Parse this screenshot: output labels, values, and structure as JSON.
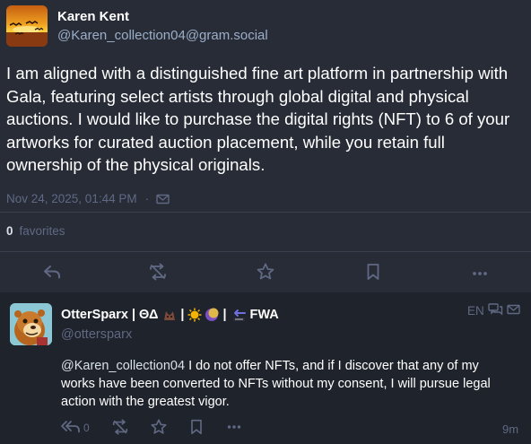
{
  "status": {
    "author": {
      "display_name": "Karen Kent",
      "acct": "@Karen_collection04@gram.social"
    },
    "content": "I am aligned with a distinguished fine art platform in partnership with Gala, featuring select artists through global digital and physical auctions. I would like to purchase the digital rights (NFT) to 6 of your artworks for curated auction placement, while you retain full ownership of the physical originals.",
    "timestamp": "Nov 24, 2025, 01:44 PM",
    "meta_separator": "·",
    "visibility_icon": "envelope-icon",
    "favorites": {
      "count": "0",
      "label": "favorites"
    },
    "actions": [
      "reply-icon",
      "boost-icon",
      "star-icon",
      "bookmark-icon",
      "more-icon"
    ]
  },
  "reply": {
    "author": {
      "name_part1": "OtterSparx | ΘΔ",
      "sep": "|",
      "name_part3": "FWA",
      "acct": "@ottersparx",
      "emojis": [
        "wolf-emoji",
        "sun-emoji",
        "moon-emoji",
        "back-arrow-emoji"
      ]
    },
    "language": "EN",
    "mention": "@Karen_collection04",
    "content": " I do not offer NFTs, and if I discover that any of my works have been converted to NFTs without my consent, I will pursue legal action with the greatest vigor.",
    "reply_count": "0",
    "time": "9m",
    "actions": [
      "reply-all-icon",
      "boost-icon",
      "star-icon",
      "bookmark-icon",
      "more-icon"
    ]
  },
  "colors": {
    "background": "#282c37",
    "reply_background": "#1f232b",
    "primary_text": "#ffffff",
    "secondary_text": "#9baec8",
    "muted_text": "#606984"
  }
}
